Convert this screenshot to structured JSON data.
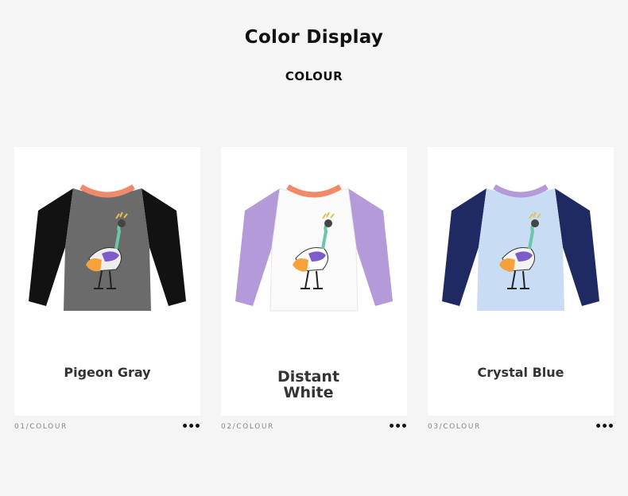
{
  "header": {
    "title": "Color Display",
    "subtitle": "COLOUR"
  },
  "items": [
    {
      "name": "Pigeon Gray",
      "index_label": "01/COLOUR",
      "more_icon": "more-dots-icon",
      "colors": {
        "body": "#6b6b6b",
        "sleeve": "#121212",
        "collar": "#f08a6a"
      }
    },
    {
      "name": "Distant White",
      "name_lines": [
        "Distant",
        "White"
      ],
      "index_label": "02/COLOUR",
      "more_icon": "more-dots-icon",
      "colors": {
        "body": "#fafafa",
        "sleeve": "#b49ad8",
        "collar": "#f08a6a"
      }
    },
    {
      "name": "Crystal Blue",
      "index_label": "03/COLOUR",
      "more_icon": "more-dots-icon",
      "colors": {
        "body": "#c8dcf4",
        "sleeve": "#1f2a63",
        "collar": "#b49ad8"
      }
    }
  ]
}
